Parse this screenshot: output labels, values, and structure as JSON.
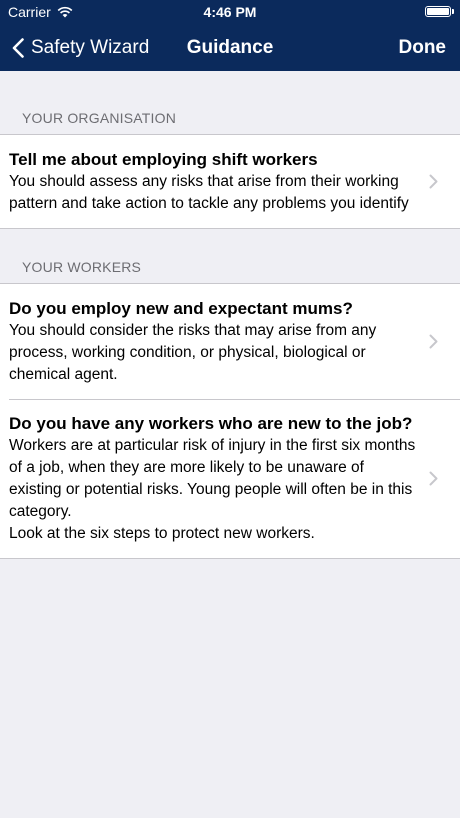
{
  "status": {
    "carrier": "Carrier",
    "time": "4:46 PM"
  },
  "nav": {
    "back_label": "Safety Wizard",
    "title": "Guidance",
    "done_label": "Done"
  },
  "sections": [
    {
      "header": "YOUR ORGANISATION",
      "items": [
        {
          "title": "Tell me about employing shift workers",
          "description": "You should assess any risks that arise from their working pattern and take action to tackle any problems you identify"
        }
      ]
    },
    {
      "header": "YOUR WORKERS",
      "items": [
        {
          "title": "Do you employ new and expectant mums?",
          "description": "You should consider the risks that may arise from any process, working condition, or physical, biological or chemical agent."
        },
        {
          "title": "Do you have any workers who are new to the job?",
          "description": "Workers are at particular risk of injury in the first six months of a job, when they are more likely to be unaware of existing or potential risks. Young people will often be in this category.\nLook at the six steps to protect new workers."
        }
      ]
    }
  ],
  "colors": {
    "nav_bar": "#0b2a5c",
    "background": "#efeff4",
    "header_text": "#6d6d72",
    "separator": "#c8c7cc"
  }
}
